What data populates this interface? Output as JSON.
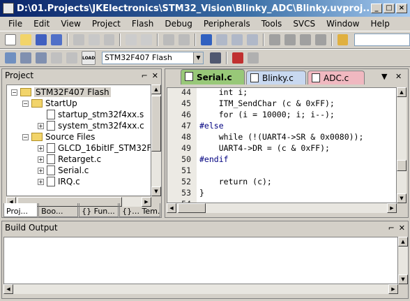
{
  "window": {
    "title": "D:\\01.Projects\\JKElectronics\\STM32_Vision\\Blinky_ADC\\Blinky.uvproj..."
  },
  "menu": [
    "File",
    "Edit",
    "View",
    "Project",
    "Flash",
    "Debug",
    "Peripherals",
    "Tools",
    "SVCS",
    "Window",
    "Help"
  ],
  "toolbar": {
    "target": "STM32F407 Flash",
    "load_label": "LOAD"
  },
  "project": {
    "title": "Project",
    "tree": [
      {
        "label": "STM32F407 Flash",
        "level": 0,
        "type": "target",
        "exp": "−"
      },
      {
        "label": "StartUp",
        "level": 1,
        "type": "folder",
        "exp": "−"
      },
      {
        "label": "startup_stm32f4xx.s",
        "level": 2,
        "type": "file",
        "exp": ""
      },
      {
        "label": "system_stm32f4xx.c",
        "level": 2,
        "type": "file",
        "exp": "+"
      },
      {
        "label": "Source Files",
        "level": 1,
        "type": "folder",
        "exp": "−"
      },
      {
        "label": "GLCD_16bitIF_STM32F",
        "level": 2,
        "type": "file",
        "exp": "+"
      },
      {
        "label": "Retarget.c",
        "level": 2,
        "type": "file",
        "exp": "+"
      },
      {
        "label": "Serial.c",
        "level": 2,
        "type": "file",
        "exp": "+"
      },
      {
        "label": "IRQ.c",
        "level": 2,
        "type": "file",
        "exp": "+"
      }
    ],
    "tabs": [
      "Proj...",
      "Boo...",
      "{} Fun...",
      "{}… Tem..."
    ]
  },
  "editor": {
    "tabs": [
      {
        "label": "Serial.c",
        "color": "#98c878",
        "active": true
      },
      {
        "label": "Blinky.c",
        "color": "#c8d8f0",
        "active": false
      },
      {
        "label": "ADC.c",
        "color": "#f0b8c0",
        "active": false
      }
    ],
    "lines": [
      {
        "n": "44",
        "code": "    int i;"
      },
      {
        "n": "45",
        "code": "    ITM_SendChar (c & 0xFF);"
      },
      {
        "n": "46",
        "code": "    for (i = 10000; i; i--);"
      },
      {
        "n": "47",
        "code": "#else"
      },
      {
        "n": "48",
        "code": "    while (!(UART4->SR & 0x0080));"
      },
      {
        "n": "49",
        "code": "    UART4->DR = (c & 0xFF);"
      },
      {
        "n": "50",
        "code": "#endif"
      },
      {
        "n": "51",
        "code": ""
      },
      {
        "n": "52",
        "code": "    return (c);"
      },
      {
        "n": "53",
        "code": "}"
      },
      {
        "n": "54",
        "code": ""
      }
    ]
  },
  "build": {
    "title": "Build Output"
  },
  "glyphs": {
    "pin": "⌐",
    "close": "✕",
    "menu_arrow": "▼",
    "up": "▲",
    "down": "▼",
    "left": "◀",
    "right": "▶"
  }
}
